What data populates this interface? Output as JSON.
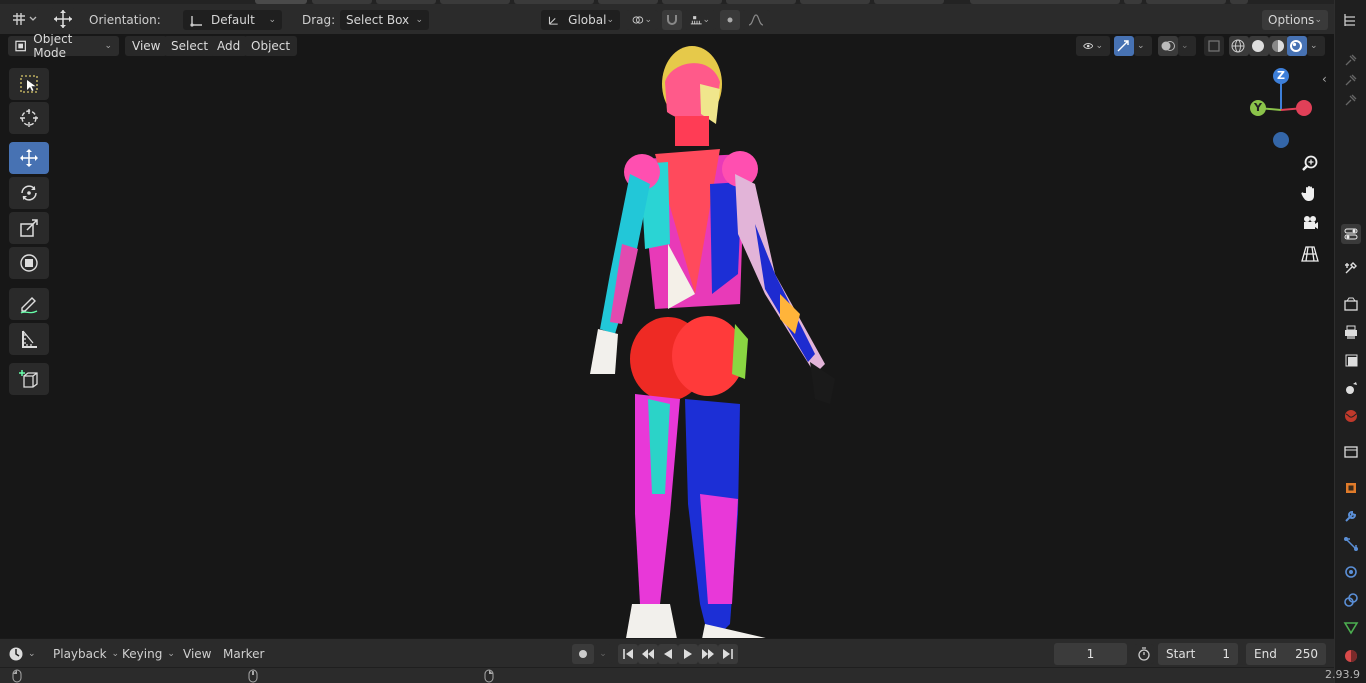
{
  "header": {
    "orientation_label": "Orientation:",
    "orientation_value": "Default",
    "drag_label": "Drag:",
    "drag_value": "Select Box",
    "transform_space": "Global",
    "options_label": "Options"
  },
  "viewport_header": {
    "mode": "Object Mode",
    "menus": [
      "View",
      "Select",
      "Add",
      "Object"
    ]
  },
  "toolbar": {
    "tools": [
      "select-box",
      "cursor",
      "move",
      "rotate",
      "scale",
      "transform",
      "annotate",
      "measure",
      "add-cube"
    ],
    "active_tool": "move"
  },
  "gizmo": {
    "axes": [
      "Z",
      "Y"
    ]
  },
  "timeline": {
    "menus": [
      "Playback",
      "Keying",
      "View",
      "Marker"
    ],
    "current_frame": "1",
    "start_label": "Start",
    "start_value": "1",
    "end_label": "End",
    "end_value": "250"
  },
  "status": {
    "version": "2.93.9"
  },
  "colors": {
    "accent": "#4772b3",
    "axis_x": "#e04058",
    "axis_y": "#8bc34a",
    "axis_z": "#3d7fd9",
    "background": "#171717"
  }
}
